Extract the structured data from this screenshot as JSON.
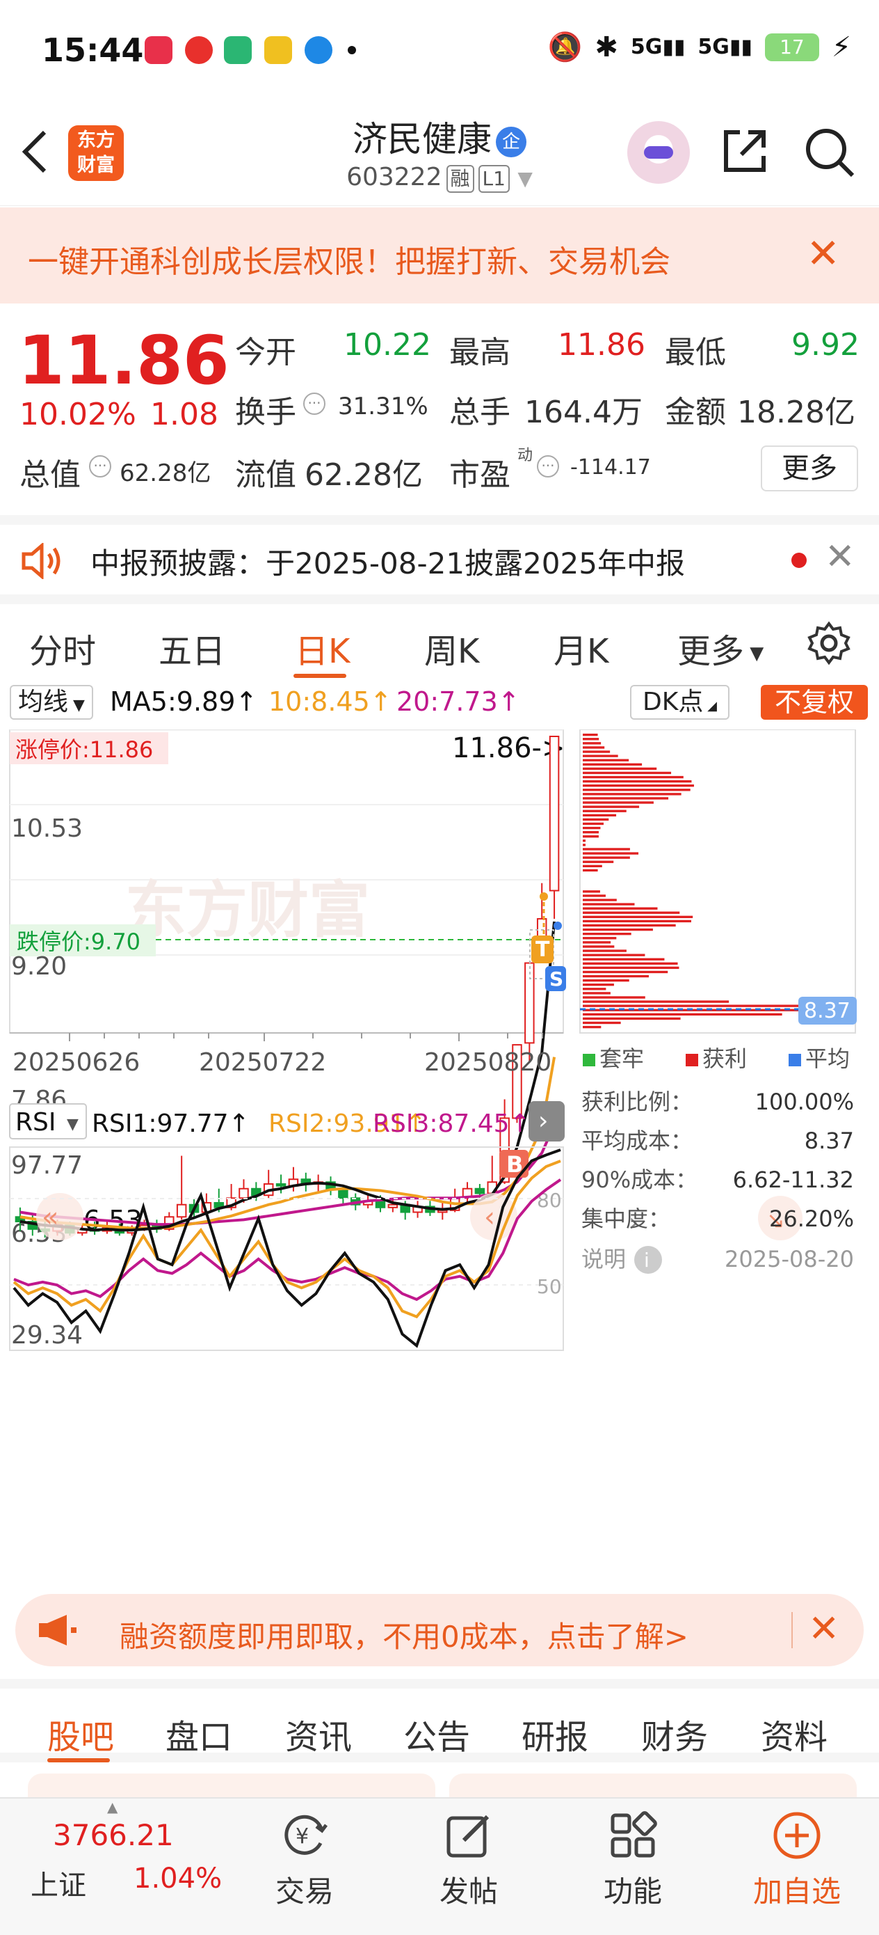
{
  "status_bar": {
    "time": "15:44",
    "apps": [
      "小红书",
      "网易云",
      "VIP",
      "影视",
      "浏览器"
    ],
    "network": "5G",
    "battery": "17"
  },
  "header": {
    "logo_text_1": "东方",
    "logo_text_2": "财富",
    "stock_name": "济民健康",
    "enterprise_badge": "企",
    "stock_code": "603222",
    "tag_margin": "融",
    "tag_level": "L1"
  },
  "promo_banner": {
    "text": "一键开通科创成长层权限！把握打新、交易机会"
  },
  "quote": {
    "price": "11.86",
    "change_pct": "10.02%",
    "change_amt": "1.08",
    "open_label": "今开",
    "open_value": "10.22",
    "high_label": "最高",
    "high_value": "11.86",
    "low_label": "最低",
    "low_value": "9.92",
    "turnover_label": "换手",
    "turnover_value": "31.31%",
    "volume_label": "总手",
    "volume_value": "164.4万",
    "amount_label": "金额",
    "amount_value": "18.28亿",
    "mktcap_label": "总值",
    "mktcap_value": "62.28亿",
    "float_label": "流值",
    "float_value": "62.28亿",
    "pe_label": "市盈",
    "pe_sup": "动",
    "pe_value": "-114.17",
    "more_button": "更多"
  },
  "notice": {
    "text": "中报预披露：于2025-08-21披露2025年中报"
  },
  "period_tabs": [
    "分时",
    "五日",
    "日K",
    "周K",
    "月K",
    "更多"
  ],
  "active_period": "日K",
  "chart_controls": {
    "ma_select": "均线",
    "ma5": "MA5:9.89↑",
    "ma10": "10:8.45↑",
    "ma20": "20:7.73↑",
    "dk_button": "DK点",
    "adjust_button": "不复权",
    "limit_up_label": "涨停价:11.86",
    "limit_down_label": "跌停价:9.70",
    "last_price_marker": "11.86->",
    "low_marker": "6.53",
    "watermark": "东方财富",
    "markers": {
      "t": "T",
      "s": "S",
      "b": "B"
    },
    "colors": {
      "up": "#e02020",
      "down": "#13a03c",
      "ma5": "#111111",
      "ma10": "#f0a020",
      "ma20": "#c0188c"
    }
  },
  "rsi_controls": {
    "select": "RSI",
    "rsi1": "RSI1:97.77↑",
    "rsi2": "RSI2:93.91↑",
    "rsi3": "RSI3:87.45↑",
    "y_top": "97.77",
    "y_bottom": "29.34",
    "level_80": "80",
    "level_50": "50"
  },
  "chip_panel": {
    "avg_cost_tag": "8.37",
    "legend": [
      "套牢",
      "获利",
      "平均"
    ],
    "rows": [
      {
        "label": "获利比例：",
        "value": "100.00%"
      },
      {
        "label": "平均成本：",
        "value": "8.37"
      },
      {
        "label": "90%成本：",
        "value": "6.62-11.32"
      },
      {
        "label": "集中度：",
        "value": "26.20%"
      }
    ],
    "note_label": "说明",
    "date": "2025-08-20"
  },
  "chart_data": {
    "type": "candlestick",
    "x_tick_labels": [
      "20250626",
      "20250722",
      "20250820"
    ],
    "y_tick_labels": [
      "6.53",
      "7.86",
      "9.20",
      "10.53",
      "11.86"
    ],
    "ylim": [
      6.53,
      11.86
    ],
    "candles": [
      [
        6.75,
        6.7,
        6.85,
        6.6
      ],
      [
        6.7,
        6.62,
        6.78,
        6.55
      ],
      [
        6.62,
        6.6,
        6.7,
        6.53
      ],
      [
        6.6,
        6.66,
        6.72,
        6.55
      ],
      [
        6.66,
        6.58,
        6.7,
        6.55
      ],
      [
        6.58,
        6.62,
        6.68,
        6.55
      ],
      [
        6.62,
        6.6,
        6.7,
        6.56
      ],
      [
        6.6,
        6.64,
        6.72,
        6.57
      ],
      [
        6.64,
        6.58,
        6.68,
        6.55
      ],
      [
        6.58,
        6.62,
        6.66,
        6.55
      ],
      [
        6.62,
        6.66,
        6.72,
        6.6
      ],
      [
        6.66,
        6.62,
        6.72,
        6.58
      ],
      [
        6.62,
        6.75,
        6.8,
        6.6
      ],
      [
        6.75,
        6.88,
        7.4,
        6.72
      ],
      [
        6.88,
        6.8,
        6.95,
        6.75
      ],
      [
        6.8,
        6.9,
        7.0,
        6.76
      ],
      [
        6.9,
        6.85,
        7.05,
        6.8
      ],
      [
        6.85,
        6.95,
        7.1,
        6.82
      ],
      [
        6.95,
        7.05,
        7.15,
        6.9
      ],
      [
        7.05,
        6.98,
        7.12,
        6.92
      ],
      [
        6.98,
        7.1,
        7.25,
        6.95
      ],
      [
        7.1,
        7.08,
        7.2,
        7.0
      ],
      [
        7.08,
        7.15,
        7.28,
        7.02
      ],
      [
        7.15,
        7.1,
        7.22,
        7.02
      ],
      [
        7.1,
        7.12,
        7.2,
        7.0
      ],
      [
        7.12,
        7.05,
        7.18,
        6.98
      ],
      [
        7.05,
        6.95,
        7.08,
        6.88
      ],
      [
        6.95,
        6.88,
        7.0,
        6.82
      ],
      [
        6.88,
        6.92,
        7.0,
        6.84
      ],
      [
        6.92,
        6.85,
        6.98,
        6.8
      ],
      [
        6.85,
        6.88,
        6.95,
        6.8
      ],
      [
        6.88,
        6.8,
        6.92,
        6.72
      ],
      [
        6.8,
        6.86,
        6.92,
        6.74
      ],
      [
        6.86,
        6.8,
        6.92,
        6.76
      ],
      [
        6.8,
        6.82,
        6.9,
        6.72
      ],
      [
        6.82,
        6.95,
        7.05,
        6.8
      ],
      [
        6.95,
        7.05,
        7.12,
        6.9
      ],
      [
        7.05,
        7.0,
        7.1,
        6.95
      ],
      [
        7.0,
        7.12,
        7.4,
        6.98
      ],
      [
        7.12,
        7.8,
        8.0,
        7.1
      ],
      [
        7.8,
        8.58,
        8.58,
        7.75
      ],
      [
        8.6,
        9.45,
        9.45,
        8.4
      ],
      [
        9.62,
        9.92,
        10.3,
        9.55
      ],
      [
        10.22,
        11.86,
        11.86,
        9.92
      ]
    ],
    "ma5": [
      6.7,
      6.68,
      6.66,
      6.65,
      6.64,
      6.62,
      6.61,
      6.62,
      6.61,
      6.61,
      6.62,
      6.63,
      6.65,
      6.7,
      6.74,
      6.79,
      6.84,
      6.87,
      6.93,
      6.97,
      7.03,
      7.05,
      7.08,
      7.1,
      7.11,
      7.1,
      7.08,
      7.04,
      6.99,
      6.95,
      6.9,
      6.88,
      6.86,
      6.84,
      6.83,
      6.84,
      6.9,
      6.93,
      6.99,
      7.18,
      7.49,
      7.98,
      8.5,
      9.89
    ],
    "ma10": [
      6.75,
      6.73,
      6.71,
      6.69,
      6.68,
      6.67,
      6.66,
      6.65,
      6.64,
      6.63,
      6.63,
      6.63,
      6.64,
      6.66,
      6.68,
      6.7,
      6.73,
      6.76,
      6.8,
      6.84,
      6.88,
      6.91,
      6.95,
      6.98,
      7.01,
      7.04,
      7.05,
      7.05,
      7.04,
      7.03,
      7.01,
      6.99,
      6.97,
      6.94,
      6.91,
      6.89,
      6.89,
      6.89,
      6.91,
      7.0,
      7.15,
      7.42,
      7.7,
      8.45
    ],
    "ma20": [
      6.8,
      6.78,
      6.76,
      6.75,
      6.74,
      6.73,
      6.72,
      6.71,
      6.7,
      6.69,
      6.68,
      6.67,
      6.67,
      6.67,
      6.68,
      6.69,
      6.7,
      6.71,
      6.72,
      6.74,
      6.76,
      6.78,
      6.8,
      6.82,
      6.84,
      6.86,
      6.88,
      6.9,
      6.92,
      6.93,
      6.94,
      6.95,
      6.95,
      6.95,
      6.95,
      6.95,
      6.96,
      6.97,
      6.99,
      7.04,
      7.12,
      7.27,
      7.43,
      7.73
    ],
    "rsi_range": [
      29.34,
      97.77
    ],
    "rsi1": [
      50,
      44,
      48,
      45,
      38,
      42,
      35,
      48,
      62,
      78,
      60,
      58,
      72,
      82,
      66,
      50,
      62,
      74,
      58,
      49,
      44,
      48,
      56,
      62,
      55,
      52,
      46,
      34,
      30,
      44,
      56,
      58,
      50,
      58,
      78,
      88,
      94,
      96,
      97.77
    ],
    "rsi2": [
      52,
      48,
      50,
      48,
      44,
      46,
      42,
      50,
      60,
      68,
      60,
      58,
      64,
      70,
      62,
      54,
      60,
      66,
      58,
      52,
      50,
      52,
      56,
      60,
      56,
      54,
      50,
      42,
      40,
      46,
      54,
      56,
      52,
      56,
      70,
      82,
      88,
      92,
      93.91
    ],
    "rsi3": [
      53,
      51,
      52,
      51,
      48,
      49,
      47,
      51,
      56,
      60,
      56,
      55,
      58,
      62,
      58,
      54,
      56,
      60,
      56,
      53,
      52,
      53,
      55,
      57,
      55,
      54,
      52,
      48,
      46,
      49,
      53,
      54,
      52,
      54,
      62,
      74,
      80,
      84,
      87.45
    ],
    "chip_distribution": {
      "price_range": [
        6.53,
        11.86
      ],
      "avg_cost": 8.37
    }
  },
  "bottom_ad": {
    "text": "融资额度即用即取，不用0成本，点击了解>"
  },
  "content_tabs": [
    "股吧",
    "盘口",
    "资讯",
    "公告",
    "研报",
    "财务",
    "资料"
  ],
  "active_content_tab": "股吧",
  "bottom_nav": {
    "index_value": "3766.21",
    "index_name": "上证",
    "index_pct": "1.04%",
    "items": [
      "交易",
      "发帖",
      "功能",
      "加自选"
    ]
  }
}
